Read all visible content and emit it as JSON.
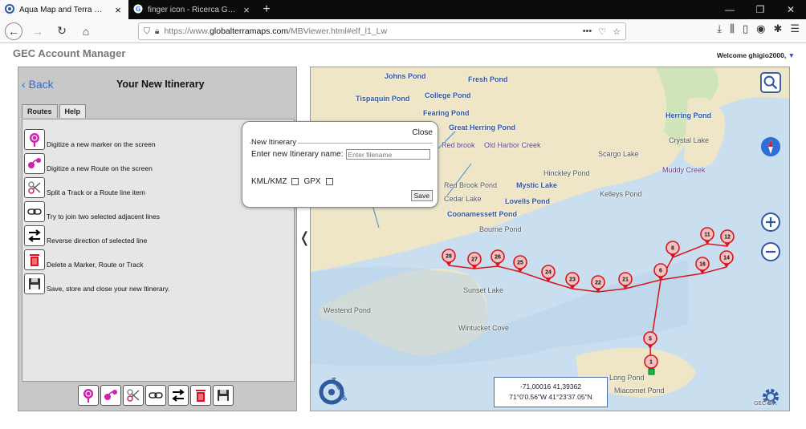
{
  "browser": {
    "tabs": [
      {
        "title": "Aqua Map and Terra Map Viewer"
      },
      {
        "title": "finger icon - Ricerca Google"
      }
    ],
    "new_tab": "+",
    "url_prefix": "https://www.",
    "url_host": "globalterramaps.com",
    "url_path": "/MBViewer.html#elf_l1_Lw",
    "url_actions": "•••"
  },
  "page": {
    "title": "GEC Account Manager",
    "welcome": "Welcome ghigio2000,"
  },
  "panel": {
    "back_label": "Back",
    "title": "Your New Itinerary",
    "tabs": [
      {
        "label": "Routes"
      },
      {
        "label": "Help"
      }
    ],
    "help_items": [
      {
        "icon": "new-marker-icon",
        "text": "Digitize a new marker on the screen"
      },
      {
        "icon": "new-route-icon",
        "text": "Digitize a new Route on the screen"
      },
      {
        "icon": "scissors-icon",
        "text": "Split a Track or a Route line item"
      },
      {
        "icon": "link-icon",
        "text": "Try to join two selected adjacent lines"
      },
      {
        "icon": "reverse-arrows-icon",
        "text": "Reverse direction of selected line"
      },
      {
        "icon": "trash-icon",
        "text": "Delete a Marker, Route or Track"
      },
      {
        "icon": "floppy-save-icon",
        "text": "Save, store and close your new Itinerary."
      }
    ],
    "collapse_glyph": "❬"
  },
  "dialog": {
    "close_label": "Close",
    "legend": "New Itinerary",
    "name_label": "Enter new Itinerary name:",
    "name_placeholder": "Enter filename",
    "kml_label": "KML/KMZ",
    "gpx_label": "GPX",
    "save_label": "Save"
  },
  "map": {
    "places": [
      {
        "name": "Johns Pond"
      },
      {
        "name": "Fresh Pond"
      },
      {
        "name": "Tispaquin Pond"
      },
      {
        "name": "College Pond"
      },
      {
        "name": "Fearing Pond"
      },
      {
        "name": "Great Herring Pond"
      },
      {
        "name": "Herring Pond"
      },
      {
        "name": "Crystal Lake"
      },
      {
        "name": "Red brook"
      },
      {
        "name": "Old Harbor Creek"
      },
      {
        "name": "Scargo Lake"
      },
      {
        "name": "Muddy Creek"
      },
      {
        "name": "Hinckley Pond"
      },
      {
        "name": "Red Brook Pond"
      },
      {
        "name": "Mystic Lake"
      },
      {
        "name": "Cedar Lake"
      },
      {
        "name": "Lovells Pond"
      },
      {
        "name": "Kelleys Pond"
      },
      {
        "name": "Coonamessett Pond"
      },
      {
        "name": "Bourne Pond"
      },
      {
        "name": "Sunset Lake"
      },
      {
        "name": "Westend Pond"
      },
      {
        "name": "Wintucket Cove"
      },
      {
        "name": "Long Pond"
      },
      {
        "name": "Miacomet Pond"
      }
    ],
    "markers": [
      {
        "label": "28"
      },
      {
        "label": "27"
      },
      {
        "label": "26"
      },
      {
        "label": "25"
      },
      {
        "label": "24"
      },
      {
        "label": "23"
      },
      {
        "label": "22"
      },
      {
        "label": "21"
      },
      {
        "label": "6"
      },
      {
        "label": "8"
      },
      {
        "label": "11"
      },
      {
        "label": "12"
      },
      {
        "label": "16"
      },
      {
        "label": "14"
      },
      {
        "label": "5"
      },
      {
        "label": "1"
      }
    ],
    "coordinates": {
      "decimal": "-71,00016 41,39362",
      "dms": "71°0'0.56\"W 41°23'37.05\"N"
    },
    "logo_text": "Aqua Map",
    "attribution": "GEC Sr..."
  },
  "colors": {
    "route": "#d8141c",
    "water": "#c9dff0",
    "land": "#efe6c8",
    "accent": "#2e5aa0",
    "magenta": "#d020b0"
  }
}
